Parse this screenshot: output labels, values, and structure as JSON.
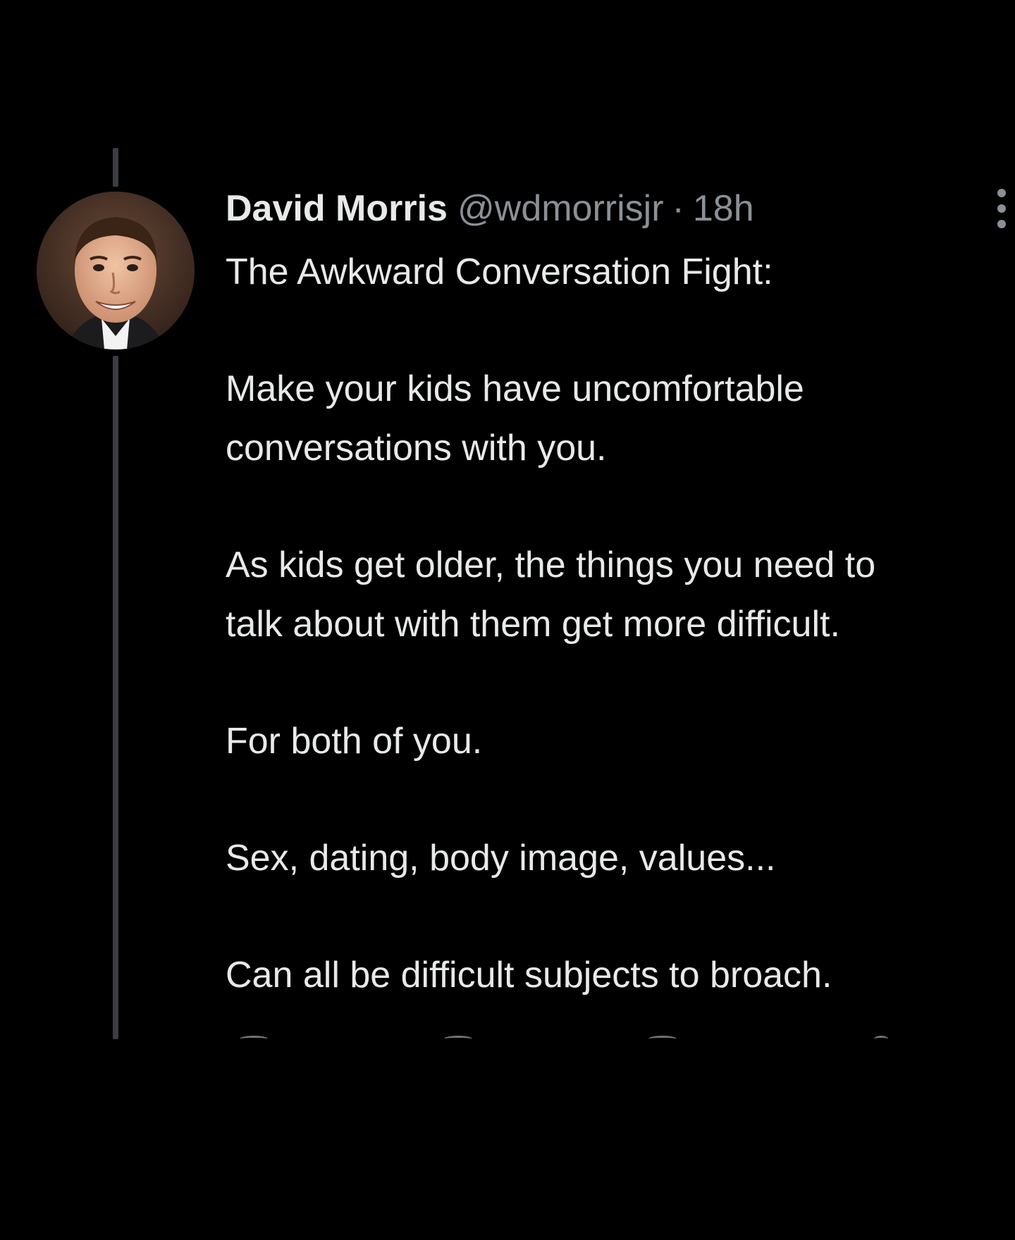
{
  "tweet": {
    "author_name": "David Morris",
    "handle": "@wdmorrisjr",
    "separator": "·",
    "time": "18h",
    "paragraphs": [
      "The Awkward Conversation Fight:",
      "Make your kids have uncomfortable\nconversations with you.",
      "As kids get older, the things you need to\ntalk about with them get more difficult.",
      "For both of you.",
      "Sex, dating, body image, values...",
      "Can all be difficult subjects to broach."
    ]
  },
  "icons": {
    "avatar": "profile-photo",
    "more": "more-options-icon",
    "actions": [
      "reply-icon",
      "retweet-icon",
      "like-icon",
      "share-icon"
    ]
  },
  "colors": {
    "background": "#000000",
    "text": "#e7e9ea",
    "secondary_text": "#8b9096",
    "thread_line": "#3a3d41"
  }
}
